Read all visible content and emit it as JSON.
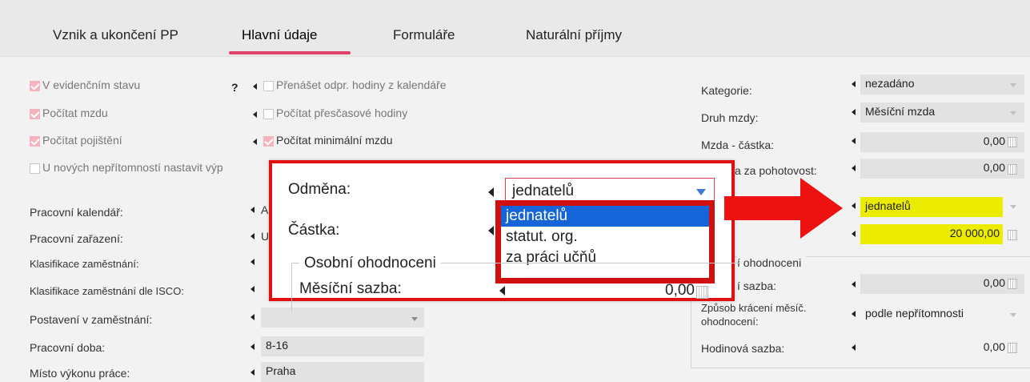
{
  "tabs": [
    {
      "label": "Vznik a ukončení PP"
    },
    {
      "label": "Hlavní údaje"
    },
    {
      "label": "Formuláře"
    },
    {
      "label": "Naturální příjmy"
    }
  ],
  "checks": {
    "v_evidencnim_stavu": "V evidenčním stavu",
    "pocitat_mzdu": "Počítat mzdu",
    "pocitat_pojisteni": "Počítat pojištění",
    "u_novych": "U nových nepřítomností nastavit výp",
    "prenaset": "Přenášet odpr. hodiny z kalendáře",
    "prescas": "Počítat přesčasové hodiny",
    "minimalni": "Počítat minimální mzdu",
    "help": "?"
  },
  "left": {
    "pracovni_kalendar": "Pracovní kalendář:",
    "pracovni_zarazeni": "Pracovní zařazení:",
    "klasifikace": "Klasifikace zaměstnání:",
    "klasifikace_isco": "Klasifikace zaměstnání dle ISCO:",
    "postaveni": "Postavení v zaměstnání:",
    "pracovni_doba": "Pracovní doba:",
    "misto": "Místo výkonu práce:",
    "kalendar_val": "A",
    "zarazeni_val": "U",
    "doba_val": "8-16",
    "misto_val": "Praha"
  },
  "right": {
    "kategorie": "Kategorie:",
    "kategorie_val": "nezadáno",
    "druh_mzdy": "Druh mzdy:",
    "druh_mzdy_val": "Měsíční mzda",
    "mzda_castka": "Mzda - částka:",
    "mzda_castka_val": "0,00",
    "pohotovost": "a za pohotovost:",
    "pohotovost_val": "0,00",
    "odmena_val": "jednatelů",
    "castka_val": "20 000,00",
    "osobni_legend": "í ohodnoceni",
    "mesicni_sazba": "í sazba:",
    "mesicni_sazba_val": "0,00",
    "zpusob_1": "Způsob krácení měsíč.",
    "zpusob_2": "ohodnocení:",
    "zpusob_val": "podle nepřítomnosti",
    "hodinova": "Hodinová sazba:",
    "hodinova_val": "0,00"
  },
  "popup": {
    "odmena_label": "Odměna:",
    "castka_label": "Částka:",
    "selected": "jednatelů",
    "options": [
      "jednatelů",
      "statut. org.",
      "za práci učňů"
    ],
    "legend": "Osobní ohodnoceni",
    "mesicni_label": "Měsíční sazba:",
    "mesicni_val": "0,00"
  },
  "colors": {
    "accent": "#e0406a",
    "highlight": "#ecec00",
    "selection": "#1565d8",
    "callout_red": "#e01010"
  }
}
